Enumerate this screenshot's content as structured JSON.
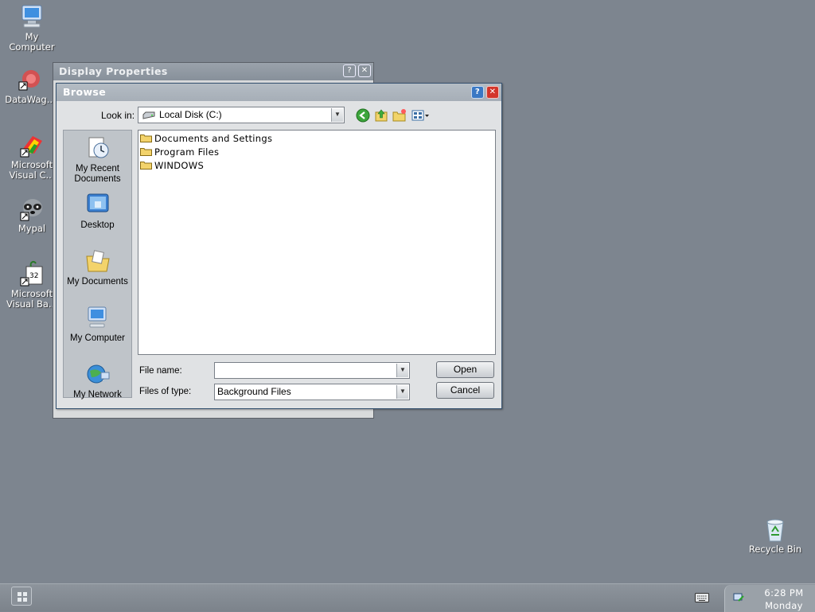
{
  "desktop": {
    "icons": [
      {
        "label": "My\nComputer",
        "icon": "my-computer-icon"
      },
      {
        "label": "DataWag...",
        "icon": "datawag-icon"
      },
      {
        "label": "Microsoft\nVisual C...",
        "icon": "visual-c-icon"
      },
      {
        "label": "Mypal",
        "icon": "mypal-raccoon-icon"
      },
      {
        "label": "Microsoft\nVisual Ba...",
        "icon": "visual-basic-icon"
      },
      {
        "label": "Recycle Bin",
        "icon": "recycle-bin-icon"
      }
    ]
  },
  "display_window": {
    "title": "Display Properties"
  },
  "browse": {
    "title": "Browse",
    "look_in_label": "Look in:",
    "look_in_value": "Local Disk (C:)",
    "places": [
      {
        "label": "My Recent\nDocuments",
        "icon": "recent-documents-icon"
      },
      {
        "label": "Desktop",
        "icon": "desktop-icon"
      },
      {
        "label": "My Documents",
        "icon": "my-documents-icon"
      },
      {
        "label": "My Computer",
        "icon": "my-computer-icon"
      },
      {
        "label": "My Network",
        "icon": "my-network-icon"
      }
    ],
    "files": [
      "Documents and Settings",
      "Program Files",
      "WINDOWS"
    ],
    "file_name_label": "File name:",
    "file_name_value": "",
    "files_of_type_label": "Files of type:",
    "files_of_type_value": "Background Files",
    "open_label": "Open",
    "cancel_label": "Cancel"
  },
  "taskbar": {
    "time": "6:28 PM",
    "day": "Monday"
  },
  "colors": {
    "desktop": "#7d858f",
    "dialog": "#e0e2e4",
    "close": "#d3352a",
    "help": "#3a78c4"
  }
}
